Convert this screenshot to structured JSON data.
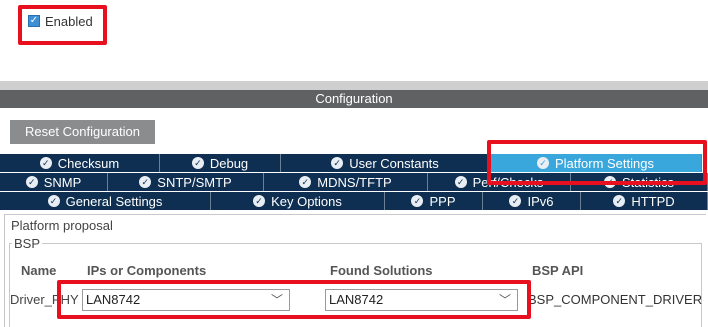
{
  "enabled": {
    "label": "Enabled",
    "checked": true
  },
  "config_header": "Configuration",
  "reset_button": "Reset Configuration",
  "tabs": {
    "row1": [
      {
        "label": "Checksum",
        "active": false
      },
      {
        "label": "Debug",
        "active": false
      },
      {
        "label": "User Constants",
        "active": false
      },
      {
        "label": "Platform Settings",
        "active": true
      }
    ],
    "row2": [
      {
        "label": "SNMP"
      },
      {
        "label": "SNTP/SMTP"
      },
      {
        "label": "MDNS/TFTP"
      },
      {
        "label": "Perf/Checks"
      },
      {
        "label": "Statistics"
      }
    ],
    "row3": [
      {
        "label": "General Settings"
      },
      {
        "label": "Key Options"
      },
      {
        "label": "PPP"
      },
      {
        "label": "IPv6"
      },
      {
        "label": "HTTPD"
      }
    ]
  },
  "platform": {
    "legend": "Platform proposal",
    "bsp_legend": "BSP",
    "columns": {
      "name": "Name",
      "ips": "IPs or Components",
      "found": "Found Solutions",
      "api": "BSP API"
    },
    "row": {
      "name": "Driver_PHY",
      "ips_value": "LAN8742",
      "found_value": "LAN8742",
      "api": "BSP_COMPONENT_DRIVER"
    }
  },
  "icons": {
    "tab_status": "check-circle-icon",
    "dropdown": "chevron-down-icon",
    "checkbox": "checkmark-icon"
  },
  "colors": {
    "annotation": "#e8101e",
    "tab_bg": "#0e2f52",
    "tab_active": "#3aa7dc",
    "header_bar": "#5f6163"
  }
}
